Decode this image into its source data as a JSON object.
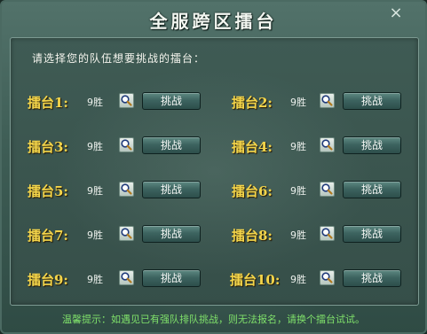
{
  "window": {
    "title": "全服跨区擂台",
    "close_glyph": "×"
  },
  "instruction": "请选择您的队伍想要挑战的擂台：",
  "arenas": [
    {
      "label": "擂台1:",
      "wins": "9胜",
      "button": "挑战"
    },
    {
      "label": "擂台2:",
      "wins": "9胜",
      "button": "挑战"
    },
    {
      "label": "擂台3:",
      "wins": "9胜",
      "button": "挑战"
    },
    {
      "label": "擂台4:",
      "wins": "9胜",
      "button": "挑战"
    },
    {
      "label": "擂台5:",
      "wins": "9胜",
      "button": "挑战"
    },
    {
      "label": "擂台6:",
      "wins": "9胜",
      "button": "挑战"
    },
    {
      "label": "擂台7:",
      "wins": "9胜",
      "button": "挑战"
    },
    {
      "label": "擂台8:",
      "wins": "9胜",
      "button": "挑战"
    },
    {
      "label": "擂台9:",
      "wins": "9胜",
      "button": "挑战"
    },
    {
      "label": "擂台10:",
      "wins": "9胜",
      "button": "挑战"
    }
  ],
  "footer_tip": "温馨提示：如遇见已有强队排队挑战，则无法报名，请换个擂台试试。",
  "icons": {
    "search": "magnifier-icon",
    "close": "close-icon"
  },
  "colors": {
    "arena_label": "#f4d54a",
    "tip_text": "#7fe06a",
    "title_text": "#f3f7f1"
  }
}
